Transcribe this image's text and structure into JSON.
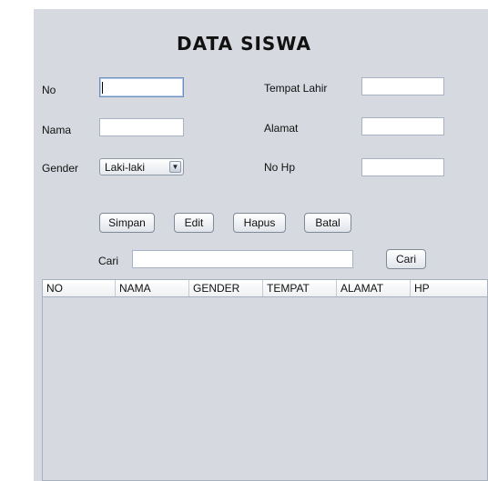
{
  "form": {
    "title": "DATA SISWA",
    "labels": {
      "no": "No",
      "nama": "Nama",
      "gender": "Gender",
      "tempat_lahir": "Tempat Lahir",
      "alamat": "Alamat",
      "no_hp": "No Hp",
      "cari": "Cari"
    },
    "gender_selected": "Laki-laki",
    "fields": {
      "no": "",
      "nama": "",
      "tempat_lahir": "",
      "alamat": "",
      "no_hp": "",
      "cari": ""
    }
  },
  "buttons": {
    "simpan": "Simpan",
    "edit": "Edit",
    "hapus": "Hapus",
    "batal": "Batal",
    "cari": "Cari"
  },
  "table": {
    "columns": [
      "NO",
      "NAMA",
      "GENDER",
      "TEMPAT",
      "ALAMAT",
      "HP"
    ],
    "rows": []
  }
}
